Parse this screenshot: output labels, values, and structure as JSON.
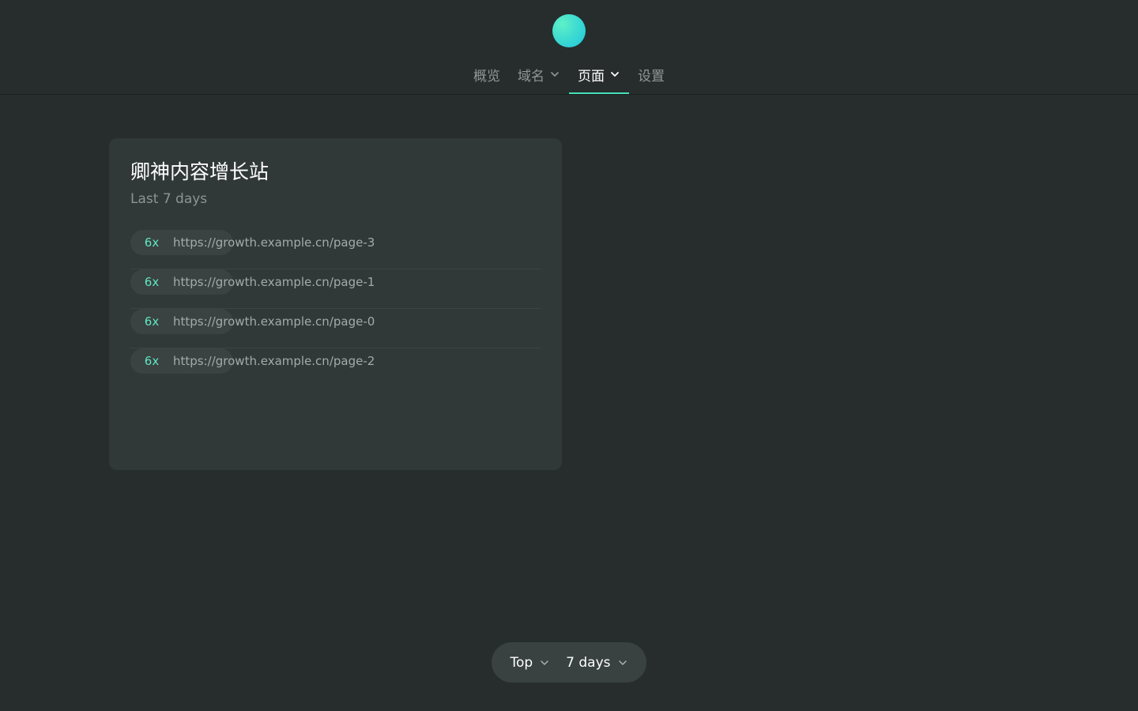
{
  "nav": {
    "items": [
      {
        "label": "概览",
        "dropdown": false,
        "active": false
      },
      {
        "label": "域名",
        "dropdown": true,
        "active": false
      },
      {
        "label": "页面",
        "dropdown": true,
        "active": true
      },
      {
        "label": "设置",
        "dropdown": false,
        "active": false
      }
    ]
  },
  "card": {
    "title": "卿神内容增长站",
    "subtitle": "Last 7 days",
    "rows": [
      {
        "count": "6x",
        "url": "https://growth.example.cn/page-3"
      },
      {
        "count": "6x",
        "url": "https://growth.example.cn/page-1"
      },
      {
        "count": "6x",
        "url": "https://growth.example.cn/page-0"
      },
      {
        "count": "6x",
        "url": "https://growth.example.cn/page-2"
      }
    ]
  },
  "bottom_bar": {
    "sort_label": "Top",
    "range_label": "7 days"
  },
  "colors": {
    "background": "#272d2d",
    "card": "#313838",
    "accent": "#47e0b8",
    "count_text": "#5fe6bf"
  }
}
